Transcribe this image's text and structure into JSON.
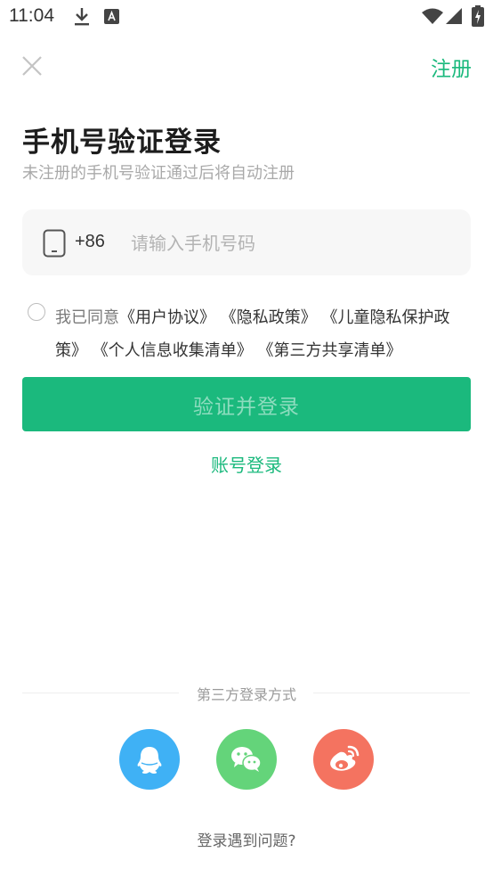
{
  "status_bar": {
    "time": "11:04"
  },
  "header": {
    "register_label": "注册"
  },
  "title": "手机号验证登录",
  "subtitle": "未注册的手机号验证通过后将自动注册",
  "phone": {
    "prefix": "+86",
    "placeholder": "请输入手机号码",
    "value": ""
  },
  "agreement": {
    "prefix_text": "我已同意",
    "links": [
      "《用户协议》",
      "《隐私政策》",
      "《儿童隐私保护政策》",
      "《个人信息收集清单》",
      "《第三方共享清单》"
    ]
  },
  "login_button_label": "验证并登录",
  "account_login_label": "账号登录",
  "third_party": {
    "label": "第三方登录方式",
    "providers": [
      {
        "name": "qq",
        "color": "#3fb1f5"
      },
      {
        "name": "wechat",
        "color": "#64d47a"
      },
      {
        "name": "weibo",
        "color": "#f47360"
      }
    ]
  },
  "problem_label": "登录遇到问题?"
}
